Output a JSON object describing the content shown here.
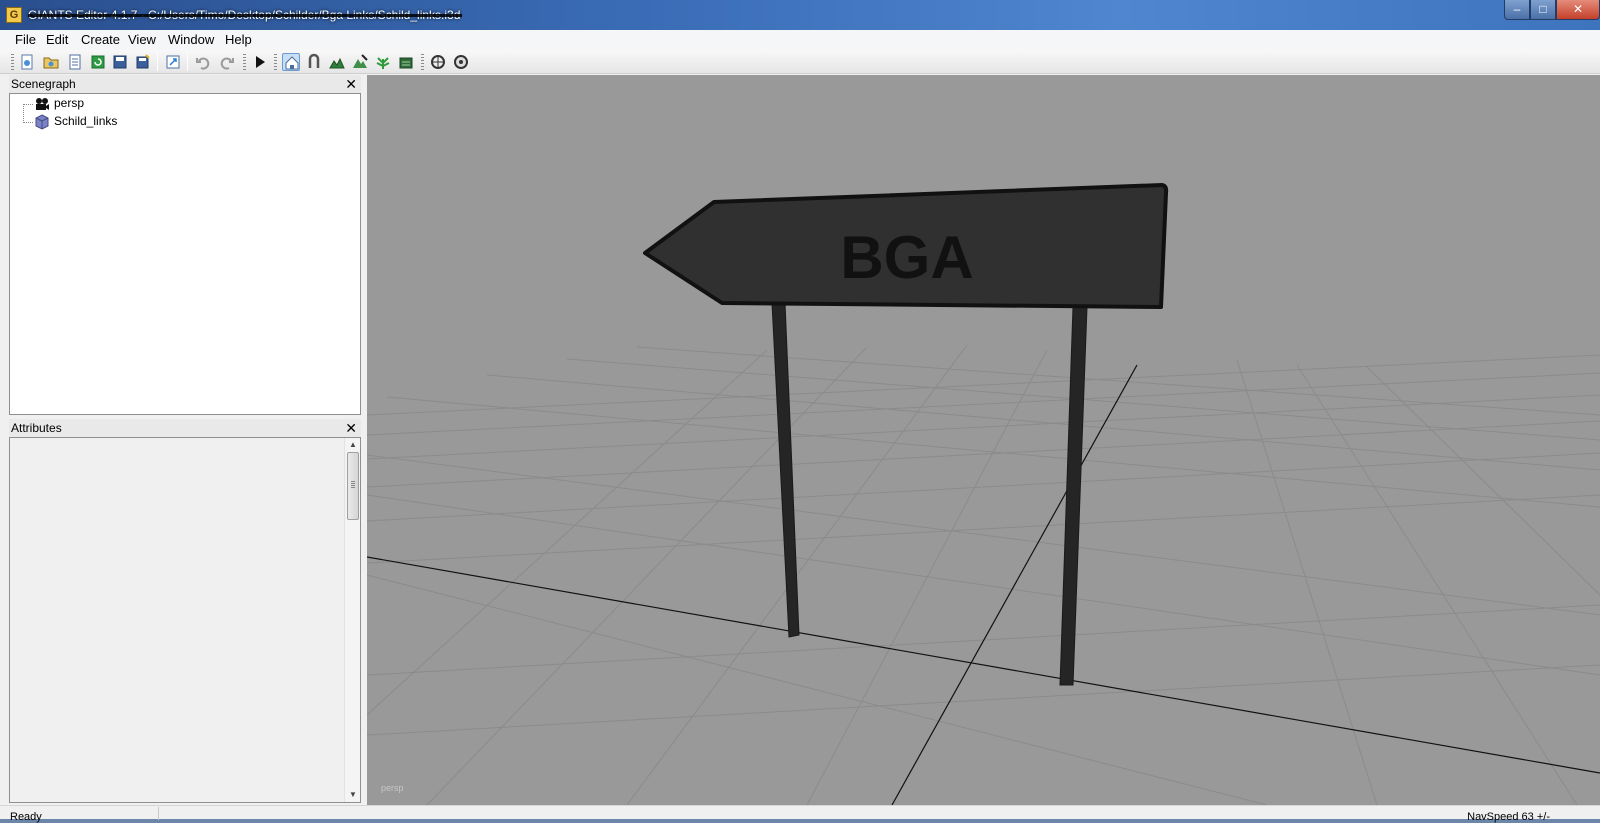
{
  "window": {
    "title": "GIANTS Editor 4.1.7 - C:/Users/Timo/Desktop/Schilder/Bga Links/Schild_links.i3d",
    "icon_letter": "G"
  },
  "caption_buttons": {
    "minimize": "–",
    "maximize": "□",
    "close": "✕"
  },
  "menu": [
    {
      "label": "File"
    },
    {
      "label": "Edit"
    },
    {
      "label": "Create"
    },
    {
      "label": "View"
    },
    {
      "label": "Window"
    },
    {
      "label": "Help"
    }
  ],
  "toolbar_icons": [
    "new-scene-icon",
    "open-scene-icon",
    "import-icon",
    "reload-icon",
    "save-icon",
    "save-as-icon",
    "export-icon",
    "undo-icon",
    "redo-icon",
    "play-icon",
    "select-tool-icon",
    "move-tool-icon",
    "terrain-sculpt-icon",
    "terrain-paint-icon",
    "foliage-paint-icon",
    "info-layer-icon",
    "shader-icon",
    "camera-settings-icon"
  ],
  "scenegraph": {
    "title": "Scenegraph",
    "close": "✕",
    "nodes": [
      {
        "label": "persp",
        "icon": "camera-icon"
      },
      {
        "label": "Schild_links",
        "icon": "shape-icon"
      }
    ]
  },
  "attributes": {
    "title": "Attributes",
    "close": "✕"
  },
  "viewport": {
    "camera_label": "persp",
    "sign_text": "BGA",
    "background": "#999999"
  },
  "statusbar": {
    "status": "Ready",
    "navspeed": "NavSpeed 63 +/-"
  }
}
